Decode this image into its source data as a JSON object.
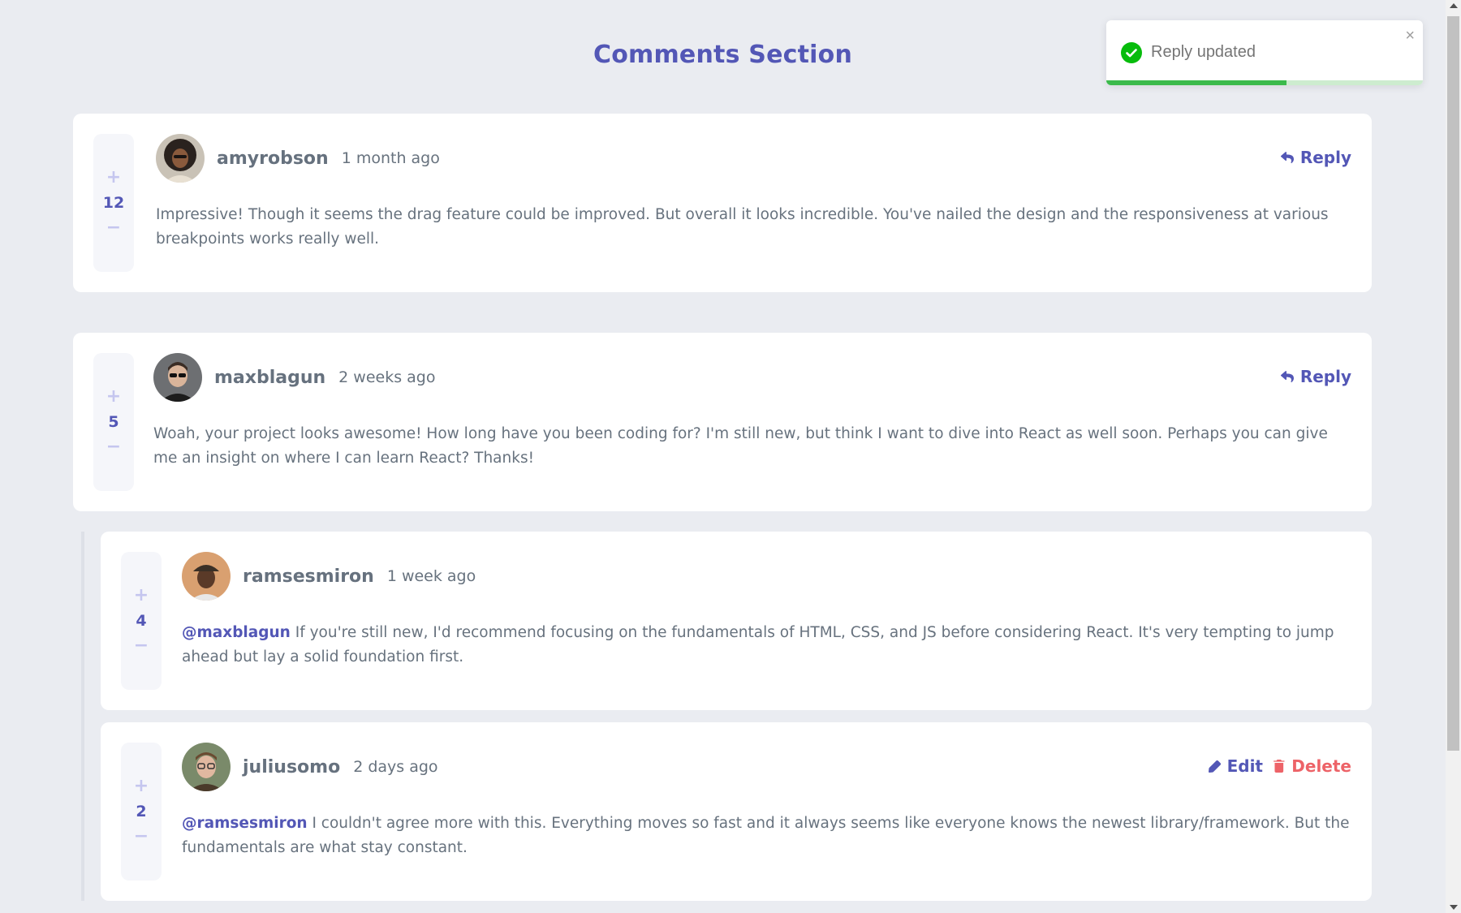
{
  "page": {
    "title": "Comments Section"
  },
  "comments": [
    {
      "score": "12",
      "username": "amyrobson",
      "time": "1 month ago",
      "content": "Impressive! Though it seems the drag feature could be improved. But overall it looks incredible. You've nailed the design and the responsiveness at various breakpoints works really well.",
      "action": "Reply"
    },
    {
      "score": "5",
      "username": "maxblagun",
      "time": "2 weeks ago",
      "content": "Woah, your project looks awesome! How long have you been coding for? I'm still new, but think I want to dive into React as well soon. Perhaps you can give me an insight on where I can learn React? Thanks!",
      "action": "Reply"
    }
  ],
  "replies": [
    {
      "score": "4",
      "username": "ramsesmiron",
      "time": "1 week ago",
      "mention": "@maxblagun",
      "content": "If you're still new, I'd recommend focusing on the fundamentals of HTML, CSS, and JS before considering React. It's very tempting to jump ahead but lay a solid foundation first."
    },
    {
      "score": "2",
      "username": "juliusomo",
      "time": "2 days ago",
      "mention": "@ramsesmiron",
      "content": "I couldn't agree more with this. Everything moves so fast and it always seems like everyone knows the newest library/framework. But the fundamentals are what stay constant.",
      "edit_label": "Edit",
      "delete_label": "Delete"
    }
  ],
  "vote": {
    "plus": "+",
    "minus": "−"
  },
  "toast": {
    "message": "Reply updated",
    "close": "×",
    "progress": 0.57
  },
  "colors": {
    "accent": "#5357b6",
    "danger": "#ed6368",
    "success": "#3bba4c",
    "background": "#eaecf1"
  },
  "icons": [
    "reply-icon",
    "edit-icon",
    "delete-icon",
    "check-circle-icon",
    "close-icon",
    "plus-icon",
    "minus-icon"
  ]
}
